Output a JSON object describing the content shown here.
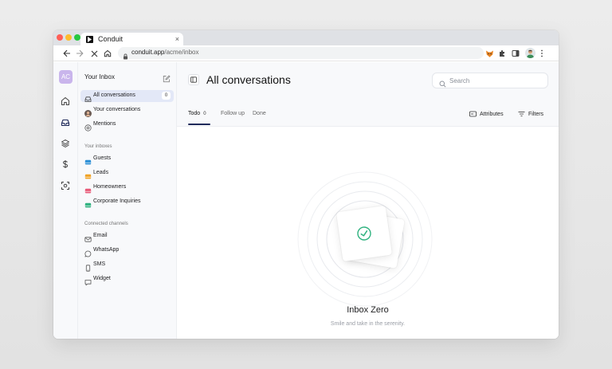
{
  "browser": {
    "tab": {
      "title": "Conduit",
      "close": "×"
    },
    "url": {
      "host": "conduit.app",
      "path": "/acme/inbox"
    }
  },
  "rail": {
    "workspace_initials": "AC"
  },
  "sidebar": {
    "title": "Your Inbox",
    "primary": [
      {
        "label": "All conversations",
        "count": "0",
        "icon": "inbox-icon"
      },
      {
        "label": "Your conversations",
        "icon": "user-avatar-icon"
      },
      {
        "label": "Mentions",
        "icon": "at-icon"
      }
    ],
    "inboxes_heading": "Your inboxes",
    "inboxes": [
      {
        "label": "Guests",
        "color": "#2b8fd6"
      },
      {
        "label": "Leads",
        "color": "#f0a326"
      },
      {
        "label": "Homeowners",
        "color": "#e85a78"
      },
      {
        "label": "Corporate Inquiries",
        "color": "#2fb27f"
      }
    ],
    "channels_heading": "Connected channels",
    "channels": [
      {
        "label": "Email",
        "icon": "mail-icon"
      },
      {
        "label": "WhatsApp",
        "icon": "whatsapp-icon"
      },
      {
        "label": "SMS",
        "icon": "phone-icon"
      },
      {
        "label": "Widget",
        "icon": "chat-widget-icon"
      }
    ]
  },
  "main": {
    "title": "All conversations",
    "search_placeholder": "Search",
    "tabs": [
      {
        "label": "Todo",
        "count": "0"
      },
      {
        "label": "Follow up"
      },
      {
        "label": "Done"
      }
    ],
    "attributes_label": "Attributes",
    "filters_label": "Filters",
    "empty_title": "Inbox Zero",
    "empty_subtitle": "Smile and take in the serenity.",
    "accent_color": "#2fb27f"
  }
}
